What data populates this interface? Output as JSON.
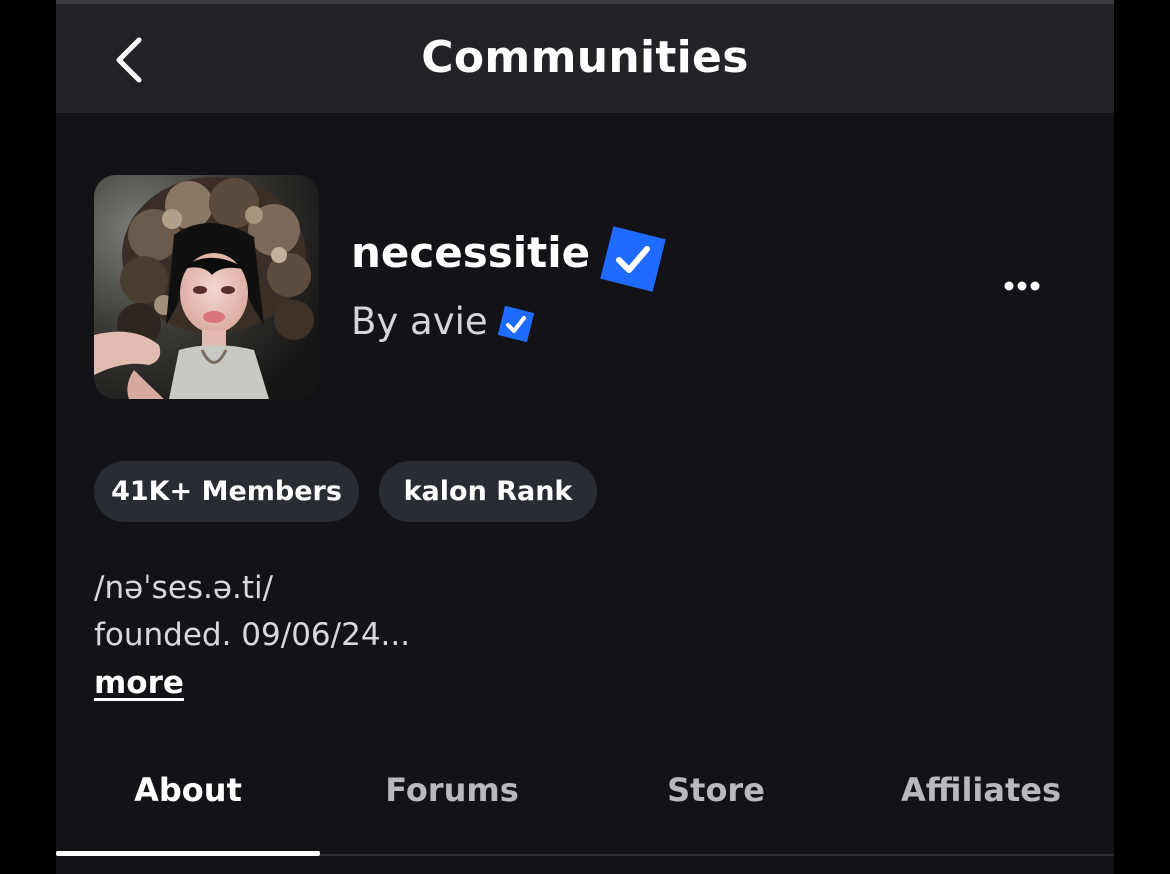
{
  "header": {
    "title": "Communities",
    "back_icon": "chevron-left-icon"
  },
  "community": {
    "name": "necessitie",
    "owner_prefix": "By",
    "owner": "avie",
    "verified_icon": "verified-badge-icon",
    "more_icon": "ellipsis-icon",
    "verified_color": "#1f6bff"
  },
  "stats": {
    "members": "41K+ Members",
    "rank": "kalon Rank"
  },
  "description": {
    "line1": "/nəˈses.ə.ti/",
    "line2": "founded. 09/06/24...",
    "more_label": "more"
  },
  "tabs": [
    {
      "label": "About",
      "active": true
    },
    {
      "label": "Forums",
      "active": false
    },
    {
      "label": "Store",
      "active": false
    },
    {
      "label": "Affiliates",
      "active": false
    }
  ]
}
